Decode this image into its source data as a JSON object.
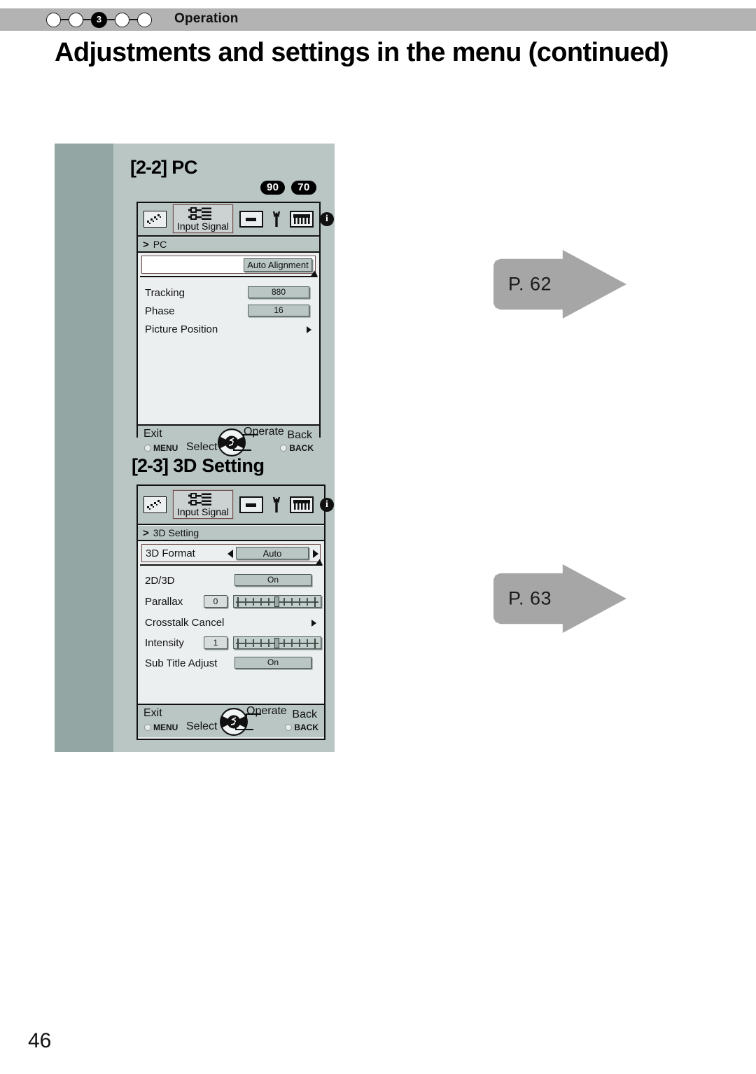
{
  "header": {
    "chapter_number": "3",
    "chapter_total_dots": 5,
    "active_dot_index": 3,
    "label": "Operation"
  },
  "page_title": "Adjustments and settings in the menu (continued)",
  "folio": "46",
  "colors": {
    "header_bar": "#b3b3b3",
    "panel_background": "#b9c6c4",
    "panel_stripe": "#93a6a3",
    "osd_body": "#eceff0",
    "arrow_gray": "#a6a6a6",
    "highlight_border": "#6d4a4a"
  },
  "sections": [
    {
      "heading_number": "[2-2]",
      "heading_title": "PC",
      "badges": [
        "90",
        "70"
      ],
      "breadcrumb": "PC",
      "breadcrumb_chevron": ">",
      "iconbar": [
        {
          "name": "picture-icon",
          "label": ""
        },
        {
          "name": "input-signal-icon",
          "label": "Input Signal"
        },
        {
          "name": "screen-icon",
          "label": ""
        },
        {
          "name": "function-wrench-icon",
          "label": ""
        },
        {
          "name": "installation-icon",
          "label": ""
        },
        {
          "name": "information-icon",
          "label": ""
        }
      ],
      "highlight_row": {
        "label": "",
        "button": "Auto Alignment"
      },
      "rows": [
        {
          "label": "Tracking",
          "type": "value",
          "value": "880"
        },
        {
          "label": "Phase",
          "type": "value",
          "value": "16"
        },
        {
          "label": "Picture Position",
          "type": "submenu",
          "value": ""
        }
      ],
      "footer": {
        "exit": "Exit",
        "menu": "MENU",
        "select": "Select",
        "operate": "Operate",
        "back": "Back",
        "back_button": "BACK"
      },
      "page_ref": "P. 62"
    },
    {
      "heading_number": "[2-3]",
      "heading_title": "3D Setting",
      "badges": [],
      "breadcrumb": "3D Setting",
      "breadcrumb_chevron": ">",
      "iconbar": [
        {
          "name": "picture-icon",
          "label": ""
        },
        {
          "name": "input-signal-icon",
          "label": "Input Signal"
        },
        {
          "name": "screen-icon",
          "label": ""
        },
        {
          "name": "function-wrench-icon",
          "label": ""
        },
        {
          "name": "installation-icon",
          "label": ""
        },
        {
          "name": "information-icon",
          "label": ""
        }
      ],
      "highlight_row": {
        "label": "3D Format",
        "button": "Auto"
      },
      "rows": [
        {
          "label": "2D/3D",
          "type": "toggle",
          "value": "On"
        },
        {
          "label": "Parallax",
          "type": "slider",
          "value": "0"
        },
        {
          "label": "Crosstalk Cancel",
          "type": "submenu",
          "value": ""
        },
        {
          "label": "Intensity",
          "type": "slider",
          "value": "1"
        },
        {
          "label": "Sub Title Adjust",
          "type": "toggle",
          "value": "On"
        }
      ],
      "footer": {
        "exit": "Exit",
        "menu": "MENU",
        "select": "Select",
        "operate": "Operate",
        "back": "Back",
        "back_button": "BACK"
      },
      "page_ref": "P. 63"
    }
  ]
}
